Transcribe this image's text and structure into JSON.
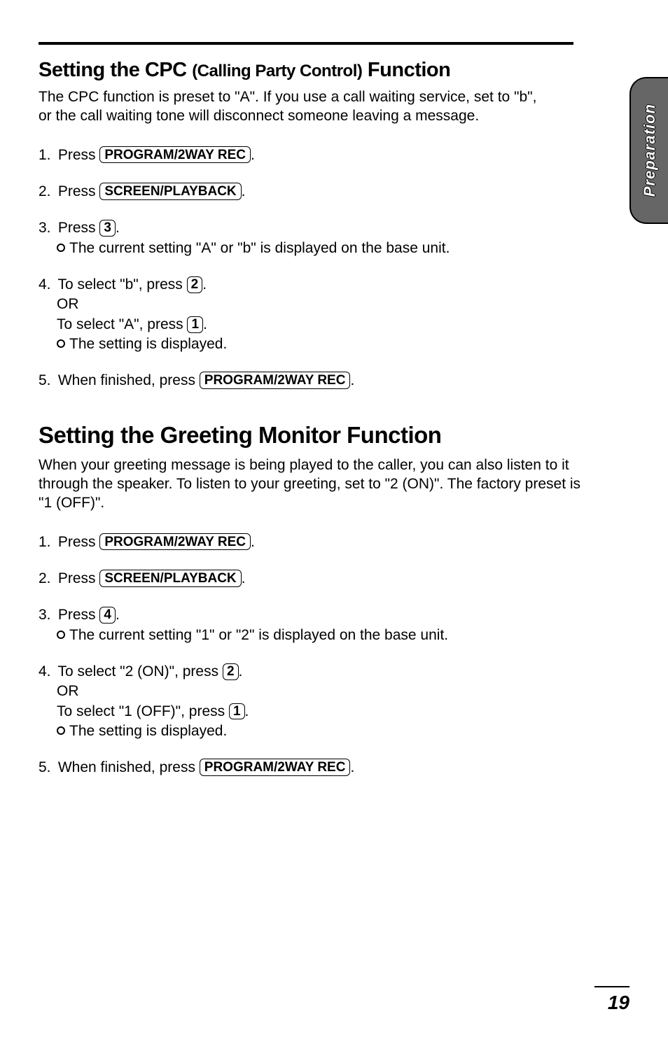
{
  "sidetab": "Preparation",
  "sections": [
    {
      "heading_main": "Setting the CPC",
      "heading_paren": "(Calling Party Control)",
      "heading_tail": "Function",
      "intro": "The CPC function is preset to \"A\". If you use a call waiting service, set to \"b\", or the call waiting tone will disconnect someone leaving a message.",
      "steps": [
        {
          "n": "1.",
          "lead": "Press ",
          "key": "PROGRAM/2WAY REC",
          "tail": "."
        },
        {
          "n": "2.",
          "lead": "Press ",
          "key": "SCREEN/PLAYBACK",
          "tail": "."
        },
        {
          "n": "3.",
          "lead": "Press ",
          "key": "3",
          "tail": ".",
          "notes": [
            {
              "bullet": true,
              "text": "The current setting \"A\" or \"b\" is displayed on the base unit."
            }
          ]
        },
        {
          "n": "4.",
          "lead": "To select \"b\", press ",
          "key": "2",
          "tail": ".",
          "extras": [
            {
              "text": "OR"
            },
            {
              "lead": "To select \"A\", press ",
              "key": "1",
              "tail": "."
            }
          ],
          "notes": [
            {
              "bullet": true,
              "text": "The setting is displayed."
            }
          ]
        },
        {
          "n": "5.",
          "lead": "When finished, press ",
          "key": "PROGRAM/2WAY REC",
          "tail": "."
        }
      ]
    },
    {
      "heading": "Setting the Greeting Monitor Function",
      "intro": "When your greeting message is being played to the caller, you can also listen to it through the speaker. To listen to your greeting, set to \"2 (ON)\". The factory preset is \"1 (OFF)\".",
      "steps": [
        {
          "n": "1.",
          "lead": "Press ",
          "key": "PROGRAM/2WAY REC",
          "tail": "."
        },
        {
          "n": "2.",
          "lead": "Press ",
          "key": "SCREEN/PLAYBACK",
          "tail": "."
        },
        {
          "n": "3.",
          "lead": "Press ",
          "key": "4",
          "tail": ".",
          "notes": [
            {
              "bullet": true,
              "text": "The current setting \"1\" or \"2\" is displayed on the base unit."
            }
          ]
        },
        {
          "n": "4.",
          "lead": "To select \"2 (ON)\", press ",
          "key": "2",
          "tail": ".",
          "extras": [
            {
              "text": "OR"
            },
            {
              "lead": "To select \"1 (OFF)\", press ",
              "key": "1",
              "tail": "."
            }
          ],
          "notes": [
            {
              "bullet": true,
              "text": "The setting is displayed."
            }
          ]
        },
        {
          "n": "5.",
          "lead": "When finished, press ",
          "key": "PROGRAM/2WAY REC",
          "tail": "."
        }
      ]
    }
  ],
  "page_number": "19"
}
